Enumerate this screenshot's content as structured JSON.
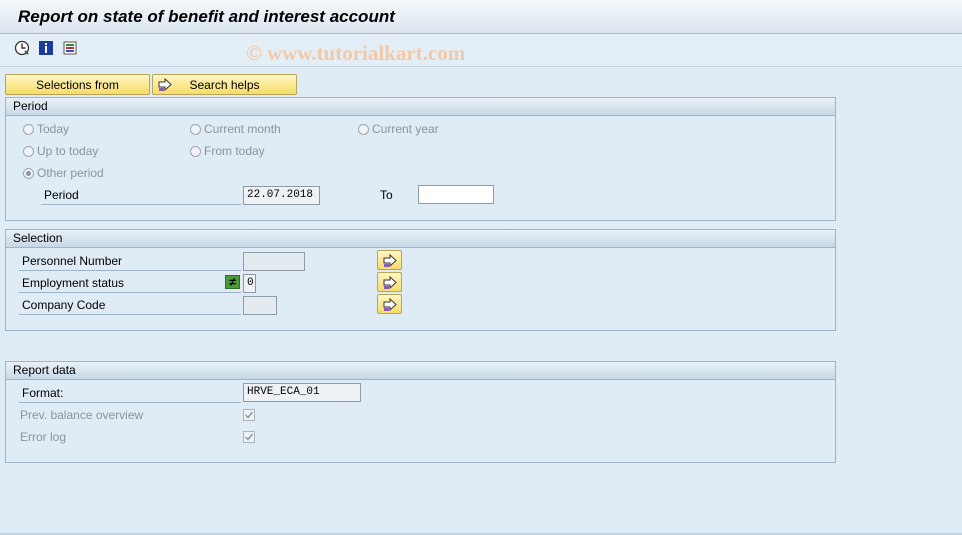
{
  "window": {
    "title": "Report on state of benefit and interest account"
  },
  "toolbar": {
    "icons": [
      "execute-clock-icon",
      "info-icon",
      "variant-list-icon"
    ],
    "watermark": "© www.tutorialkart.com"
  },
  "buttons": {
    "selections_from": "Selections from",
    "search_helps": "Search helps"
  },
  "period_group": {
    "header": "Period",
    "radios": {
      "today": "Today",
      "current_month": "Current month",
      "current_year": "Current year",
      "up_to_today": "Up to today",
      "from_today": "From today",
      "other_period": "Other period"
    },
    "selected": "other_period",
    "period_label": "Period",
    "period_from": "22.07.2018",
    "to_label": "To",
    "period_to": ""
  },
  "selection_group": {
    "header": "Selection",
    "fields": {
      "personnel_number": {
        "label": "Personnel Number",
        "value": ""
      },
      "employment_status": {
        "label": "Employment status",
        "operator": "≠",
        "value": "0"
      },
      "company_code": {
        "label": "Company Code",
        "value": ""
      }
    }
  },
  "report_group": {
    "header": "Report data",
    "format_label": "Format:",
    "format_value": "HRVE_ECA_01",
    "prev_balance_label": "Prev. balance overview",
    "prev_balance_checked": true,
    "error_log_label": "Error log",
    "error_log_checked": true
  },
  "colors": {
    "background": "#dfebf5",
    "button_yellow": "#f7dc68",
    "group_border": "#9fb5c7"
  }
}
